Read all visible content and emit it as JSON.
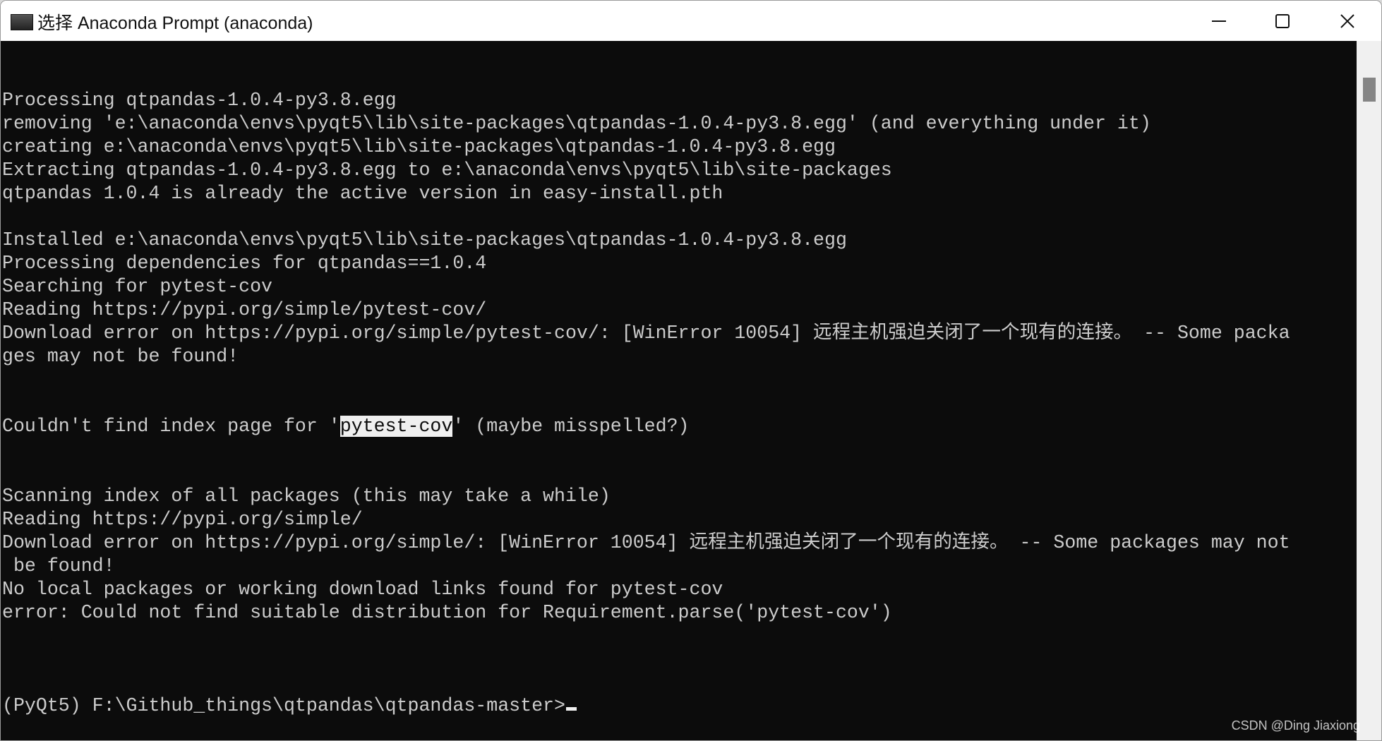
{
  "window": {
    "title": "选择 Anaconda Prompt (anaconda)",
    "icon": "terminal-icon"
  },
  "controls": {
    "minimize": "minimize-icon",
    "maximize": "maximize-icon",
    "close": "close-icon"
  },
  "terminal": {
    "lines": [
      "Processing qtpandas-1.0.4-py3.8.egg",
      "removing 'e:\\anaconda\\envs\\pyqt5\\lib\\site-packages\\qtpandas-1.0.4-py3.8.egg' (and everything under it)",
      "creating e:\\anaconda\\envs\\pyqt5\\lib\\site-packages\\qtpandas-1.0.4-py3.8.egg",
      "Extracting qtpandas-1.0.4-py3.8.egg to e:\\anaconda\\envs\\pyqt5\\lib\\site-packages",
      "qtpandas 1.0.4 is already the active version in easy-install.pth",
      "",
      "Installed e:\\anaconda\\envs\\pyqt5\\lib\\site-packages\\qtpandas-1.0.4-py3.8.egg",
      "Processing dependencies for qtpandas==1.0.4",
      "Searching for pytest-cov",
      "Reading https://pypi.org/simple/pytest-cov/",
      "Download error on https://pypi.org/simple/pytest-cov/: [WinError 10054] 远程主机强迫关闭了一个现有的连接。 -- Some packa",
      "ges may not be found!"
    ],
    "selected_line": {
      "before": "Couldn't find index page for '",
      "selected": "pytest-cov",
      "after": "' (maybe misspelled?)"
    },
    "lines2": [
      "Scanning index of all packages (this may take a while)",
      "Reading https://pypi.org/simple/",
      "Download error on https://pypi.org/simple/: [WinError 10054] 远程主机强迫关闭了一个现有的连接。 -- Some packages may not",
      " be found!",
      "No local packages or working download links found for pytest-cov",
      "error: Could not find suitable distribution for Requirement.parse('pytest-cov')",
      ""
    ],
    "prompt": "(PyQt5) F:\\Github_things\\qtpandas\\qtpandas-master>",
    "colors": {
      "background": "#0c0c0c",
      "text": "#cccccc",
      "selection": "#f0f0f0"
    }
  },
  "watermark": "CSDN @Ding Jiaxiong"
}
